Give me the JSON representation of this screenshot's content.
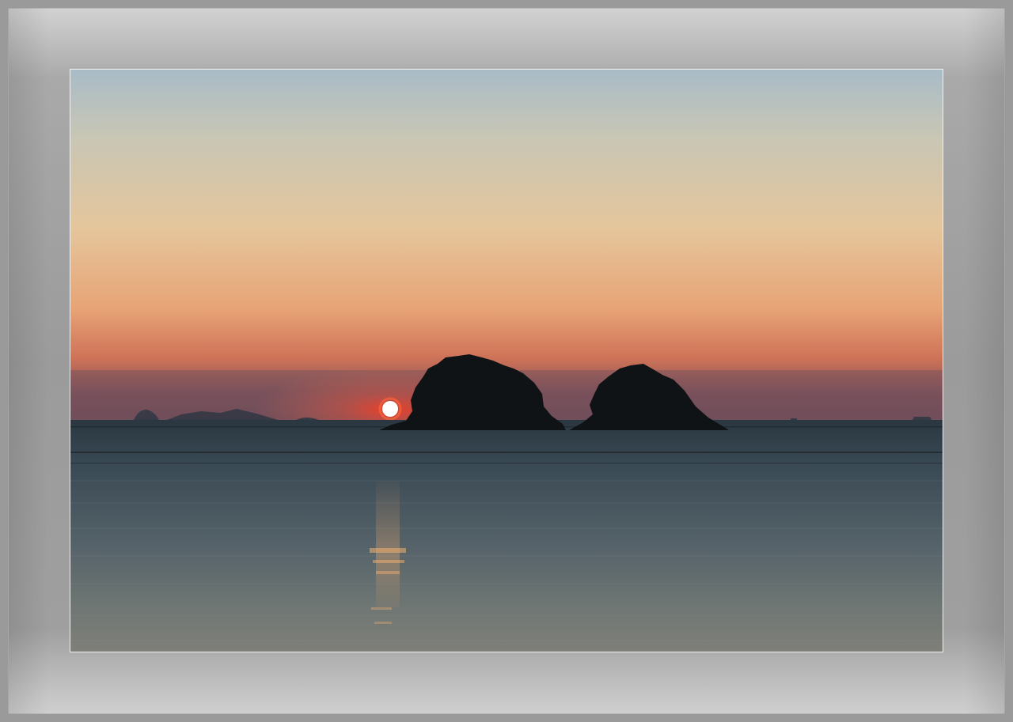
{
  "photo": {
    "subject": "sunset-over-sea-with-two-islands",
    "colors": {
      "sky_top": "#a8bcc7",
      "sky_mid": "#e4c49b",
      "sky_glow": "#e39a6b",
      "sky_horizon": "#b8534a",
      "haze_band": "#6e4b59",
      "sun": "#ffffff",
      "sun_halo": "#ff3a1e",
      "sea_near": "#7d7f7c",
      "sea_far": "#2c3a44",
      "island": "#101316",
      "frame": "#9b9b9b"
    }
  }
}
